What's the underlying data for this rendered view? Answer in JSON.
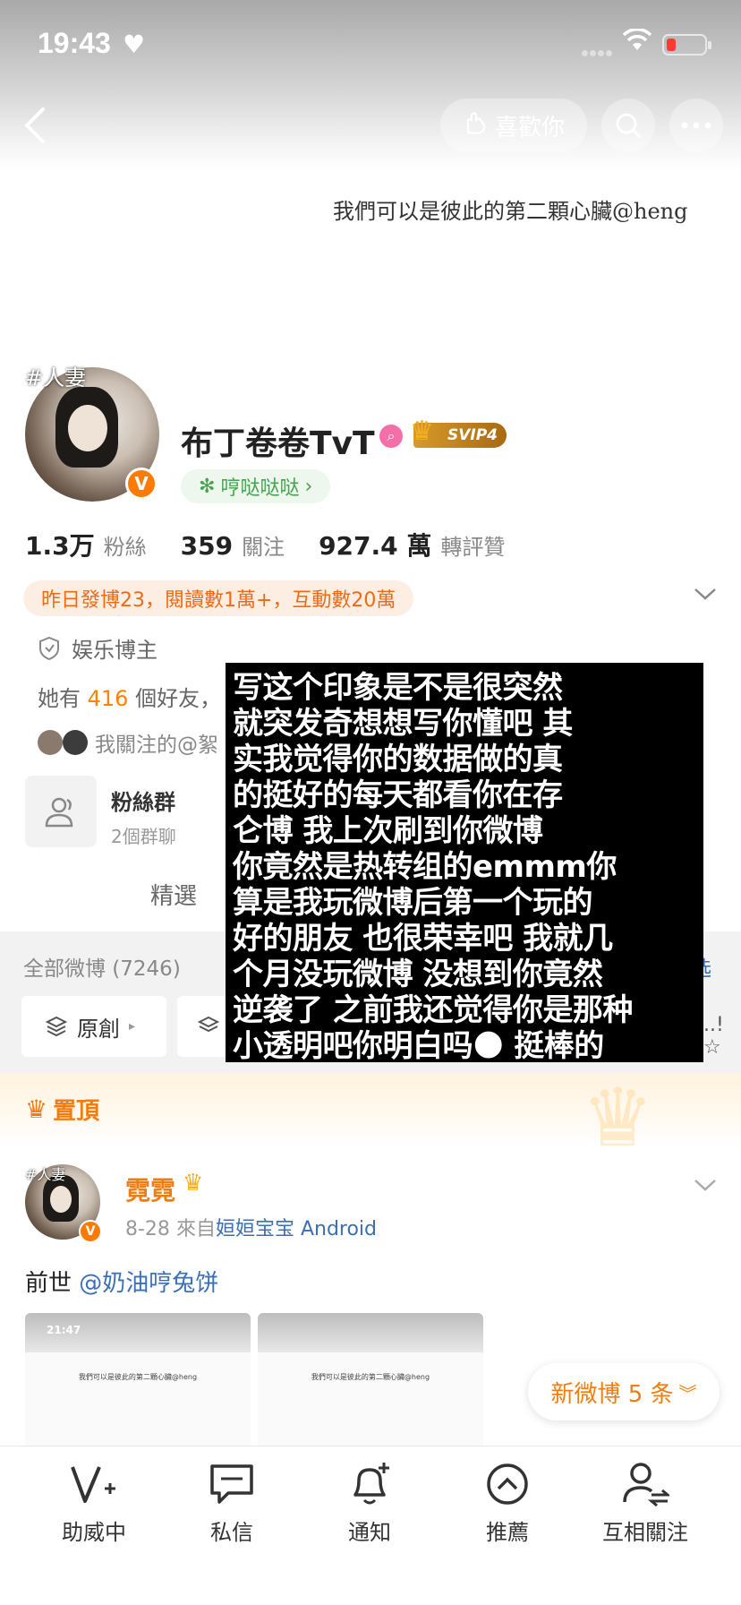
{
  "status_bar": {
    "time": "19:43",
    "heart_icon": "heart-icon",
    "wifi_icon": "wifi-icon",
    "battery_icon": "battery-low-icon"
  },
  "nav": {
    "like_label": "喜歡你"
  },
  "profile": {
    "bio": "我們可以是彼此的第二顆心臟@heng",
    "avatar_tag": "#人妻",
    "username": "布丁卷卷TvT",
    "svip_label": "SVIP4",
    "tag_pill": "哼哒哒哒",
    "stats": [
      {
        "value": "1.3万",
        "label": "粉絲"
      },
      {
        "value": "359",
        "label": "關注"
      },
      {
        "value": "927.4 萬",
        "label": "轉評贊"
      }
    ],
    "highlight": "昨日發博23，閱讀數1萬+，互動數20萬",
    "category": "娱乐博主",
    "friends_prefix": "她有",
    "friends_count": "416",
    "friends_suffix": "個好友，",
    "follow_text": "我關注的@絮",
    "fans_group_title": "粉絲群",
    "fans_group_sub": "2個群聊",
    "tab_featured": "精選"
  },
  "feed_header": {
    "all_posts": "全部微博 (7246)",
    "right_link": "选",
    "chip_original": "原創",
    "chip_tail": "..!☆"
  },
  "overlay_text": [
    "写这个印象是不是很突然",
    "就突发奇想想写你懂吧 其",
    "实我觉得你的数据做的真",
    "的挺好的每天都看你在存",
    "仑博 我上次刷到你微博",
    "你竟然是热转组的emmm你",
    "算是我玩微博后第一个玩的",
    "好的朋友 也很荣幸吧 我就几",
    "个月没玩微博 没想到你竟然",
    "逆袭了 之前我还觉得你是那种",
    "小透明吧你明白吗🌑 挺棒的"
  ],
  "pinned": {
    "label": "置頂"
  },
  "post": {
    "avatar_tag": "#人妻",
    "author": "霓霓",
    "date": "8-28",
    "from_prefix": "來自",
    "source": "姮姮宝宝 Android",
    "text_prefix": "前世",
    "mention": "@奶油哼兔饼",
    "thumb_time": "21:47",
    "thumb_caption": "我們可以是彼此的第二顆心臟@heng"
  },
  "new_posts_btn": "新微博 5 条",
  "bottom_nav": [
    {
      "label": "助威中",
      "icon": "cheer-v-icon"
    },
    {
      "label": "私信",
      "icon": "message-icon"
    },
    {
      "label": "通知",
      "icon": "bell-add-icon"
    },
    {
      "label": "推薦",
      "icon": "recommend-up-icon"
    },
    {
      "label": "互相關注",
      "icon": "mutual-follow-icon"
    }
  ],
  "colors": {
    "accent_orange": "#f07d11",
    "link_blue": "#3b6fb6",
    "green": "#47a34d"
  }
}
